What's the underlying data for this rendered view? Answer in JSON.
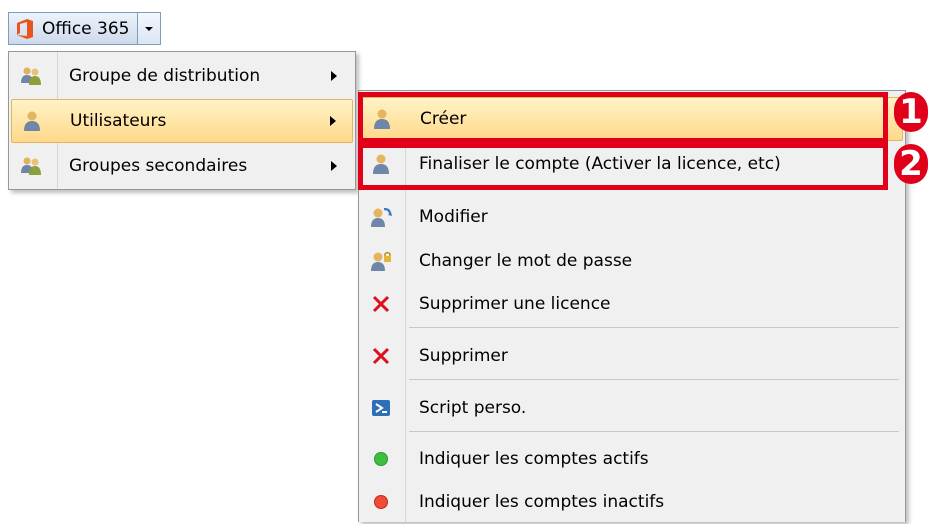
{
  "toolbar": {
    "title": "Office 365"
  },
  "menu_main": {
    "items": [
      {
        "label": "Groupe de distribution",
        "icon": "group-icon"
      },
      {
        "label": "Utilisateurs",
        "icon": "user-icon",
        "highlighted": true
      },
      {
        "label": "Groupes secondaires",
        "icon": "group-icon"
      }
    ]
  },
  "submenu": {
    "items": [
      {
        "label": "Créer",
        "icon": "user-icon"
      },
      {
        "label": "Finaliser le compte (Activer la licence, etc)",
        "icon": "user-icon"
      },
      {
        "label": "Modifier",
        "icon": "user-edit-icon"
      },
      {
        "label": "Changer le mot de passe",
        "icon": "user-lock-icon"
      },
      {
        "label": "Supprimer une licence",
        "icon": "red-x-icon"
      },
      {
        "label": "Supprimer",
        "icon": "red-x-icon"
      },
      {
        "label": "Script perso.",
        "icon": "powershell-icon"
      },
      {
        "label": "Indiquer les comptes actifs",
        "icon": "green-dot-icon"
      },
      {
        "label": "Indiquer les comptes inactifs",
        "icon": "red-dot-icon"
      }
    ]
  },
  "annotations": {
    "one": "1",
    "two": "2"
  },
  "colors": {
    "highlight": "#ffd88a",
    "annotation": "#e1001a",
    "menu_bg": "#f0f0f0"
  }
}
